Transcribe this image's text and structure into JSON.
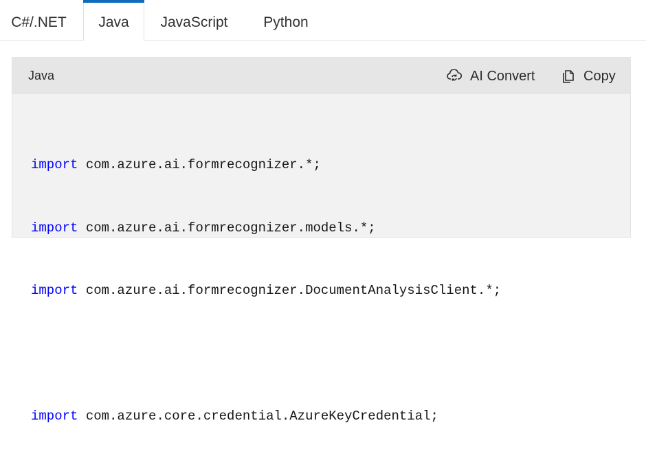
{
  "tabs": [
    {
      "label": "C#/.NET",
      "active": false
    },
    {
      "label": "Java",
      "active": true
    },
    {
      "label": "JavaScript",
      "active": false
    },
    {
      "label": "Python",
      "active": false
    }
  ],
  "code_block": {
    "language_label": "Java",
    "ai_convert_label": "AI Convert",
    "copy_label": "Copy",
    "lines": [
      {
        "keyword": "import",
        "rest": " com.azure.ai.formrecognizer.*;"
      },
      {
        "keyword": "import",
        "rest": " com.azure.ai.formrecognizer.models.*;"
      },
      {
        "keyword": "import",
        "rest": " com.azure.ai.formrecognizer.DocumentAnalysisClient.*;"
      },
      {
        "keyword": "",
        "rest": ""
      },
      {
        "keyword": "import",
        "rest": " com.azure.core.credential.AzureKeyCredential;"
      }
    ]
  },
  "colors": {
    "accent": "#0f6cbd",
    "keyword": "#0101fd",
    "code_background": "#f2f2f2",
    "header_background": "#e6e6e6"
  },
  "icons": {
    "ai_convert": "cloud-sync-icon",
    "copy": "copy-icon"
  }
}
